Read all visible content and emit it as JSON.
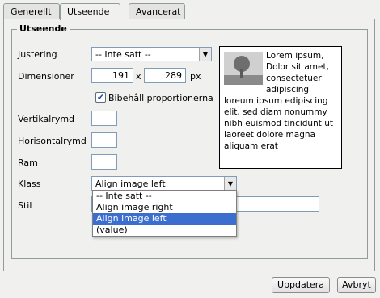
{
  "tabs": [
    "Generellt",
    "Utseende",
    "Avancerat"
  ],
  "fieldset_legend": "Utseende",
  "labels": {
    "alignment": "Justering",
    "dimensions": "Dimensioner",
    "vspace": "Vertikalrymd",
    "hspace": "Horisontalrymd",
    "border": "Ram",
    "class": "Klass",
    "style": "Stil"
  },
  "alignment_value": "-- Inte satt --",
  "width_value": "191",
  "height_value": "289",
  "times": "x",
  "unit": "px",
  "keep_proportions_label": "Bibehåll proportionerna",
  "class_value": "Align image left",
  "class_options": [
    "-- Inte satt --",
    "Align image right",
    "Align image left",
    "(value)"
  ],
  "preview_text": "Lorem ipsum, Dolor sit amet, consectetuer adipiscing loreum ipsum edipiscing elit, sed diam nonummy nibh euismod tincidunt ut laoreet dolore magna aliquam erat",
  "buttons": {
    "update": "Uppdatera",
    "cancel": "Avbryt"
  }
}
